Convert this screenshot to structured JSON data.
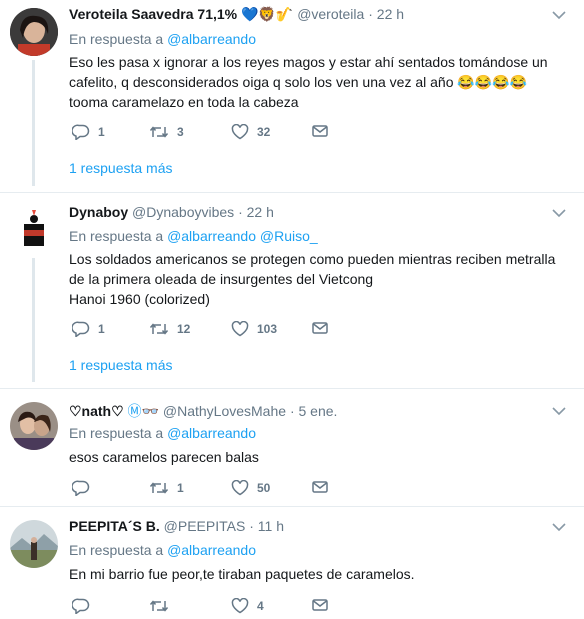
{
  "tweets": [
    {
      "name": "Veroteila Saavedra 71,1%",
      "name_emoji": "💙🦁🎷",
      "handle": "@veroteila",
      "time": "22 h",
      "reply_prefix": "En respuesta a",
      "reply_to": "@albarreando",
      "body": [
        "Eso les pasa x ignorar a los reyes magos y estar ahí sentados tomándose un",
        "cafelito, q desconsiderados oiga q solo los ven una vez al año 😂😂😂😂",
        "tooma caramelazo en toda la cabeza"
      ],
      "replies": "1",
      "retweets": "3",
      "likes": "32",
      "more": "1 respuesta más"
    },
    {
      "name": "Dynaboy",
      "handle": "@Dynaboyvibes",
      "time": "22 h",
      "reply_prefix": "En respuesta a",
      "reply_to": "@albarreando @Ruiso_",
      "body": [
        "Los soldados americanos se protegen como pueden mientras reciben metralla",
        "de la primera oleada de insurgentes del Vietcong",
        "Hanoi 1960 (colorized)"
      ],
      "replies": "1",
      "retweets": "12",
      "likes": "103",
      "more": "1 respuesta más"
    },
    {
      "name": "♡nath♡",
      "name_emoji": "Ⓜ👓",
      "handle": "@NathyLovesMahe",
      "time": "5 ene.",
      "reply_prefix": "En respuesta a",
      "reply_to": "@albarreando",
      "body": [
        "esos caramelos parecen balas"
      ],
      "replies": "",
      "retweets": "1",
      "likes": "50"
    },
    {
      "name": "PEEPITA´S B.",
      "handle": "@PEEPITAS",
      "time": "11 h",
      "reply_prefix": "En respuesta a",
      "reply_to": "@albarreando",
      "body": [
        "En mi barrio fue peor,te tiraban paquetes de caramelos."
      ],
      "replies": "",
      "retweets": "",
      "likes": "4"
    }
  ],
  "separator": "·",
  "icons": [
    "reply-icon",
    "retweet-icon",
    "like-icon",
    "dm-icon",
    "chevron-down-icon"
  ],
  "colors": {
    "link": "#1da1f2",
    "muted": "#657786",
    "thread_line": "#dfe7ec"
  }
}
